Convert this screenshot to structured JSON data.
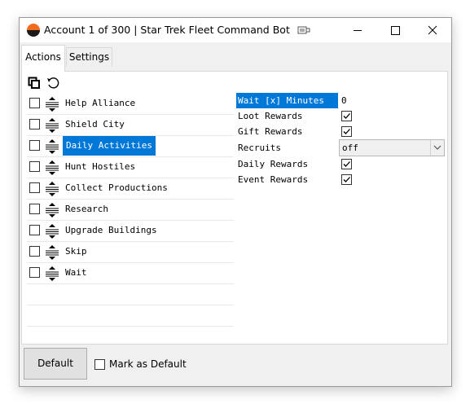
{
  "window": {
    "title": "Account 1 of 300 | Star Trek Fleet Command Bot",
    "app_icon": "star-trek-badge-icon",
    "titlebar_extra_icon": "keyboard-icon"
  },
  "tabs": [
    {
      "label": "Actions",
      "active": true
    },
    {
      "label": "Settings",
      "active": false
    }
  ],
  "toolbar": {
    "icons": [
      "copy-icon",
      "undo-icon"
    ]
  },
  "actions": [
    {
      "label": "Help Alliance",
      "checked": false,
      "selected": false
    },
    {
      "label": "Shield City",
      "checked": false,
      "selected": false
    },
    {
      "label": "Daily Activities",
      "checked": false,
      "selected": true
    },
    {
      "label": "Hunt Hostiles",
      "checked": false,
      "selected": false
    },
    {
      "label": "Collect Productions",
      "checked": false,
      "selected": false
    },
    {
      "label": "Research",
      "checked": false,
      "selected": false
    },
    {
      "label": "Upgrade Buildings",
      "checked": false,
      "selected": false
    },
    {
      "label": "Skip",
      "checked": false,
      "selected": false
    },
    {
      "label": "Wait",
      "checked": false,
      "selected": false
    }
  ],
  "properties": [
    {
      "name": "Wait [x] Minutes",
      "type": "text",
      "value": "0",
      "selected": true
    },
    {
      "name": "Loot Rewards",
      "type": "checkbox",
      "checked": true
    },
    {
      "name": "Gift Rewards",
      "type": "checkbox",
      "checked": true
    },
    {
      "name": "Recruits",
      "type": "select",
      "value": "off"
    },
    {
      "name": "Daily Rewards",
      "type": "checkbox",
      "checked": true
    },
    {
      "name": "Event Rewards",
      "type": "checkbox",
      "checked": true
    }
  ],
  "footer": {
    "default_button_label": "Default",
    "mark_default_label": "Mark as Default",
    "mark_default_checked": false
  },
  "colors": {
    "selection": "#0078d7",
    "window_bg": "#f0f0f0"
  }
}
